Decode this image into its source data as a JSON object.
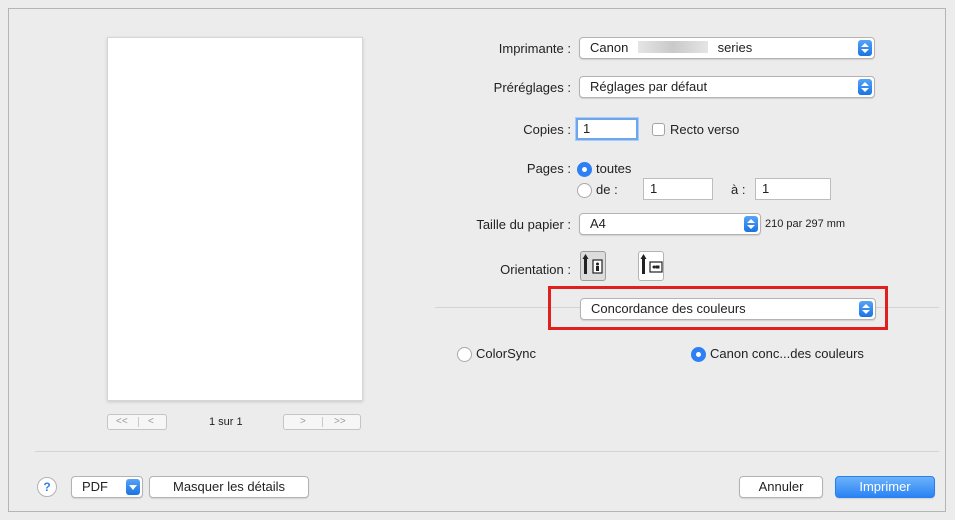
{
  "printer": {
    "label": "Imprimante :",
    "value": "Canon",
    "value_suffix": "series"
  },
  "presets": {
    "label": "Préréglages :",
    "value": "Réglages par défaut"
  },
  "copies": {
    "label": "Copies :",
    "value": "1",
    "duplex_label": "Recto verso"
  },
  "pages": {
    "label": "Pages :",
    "all_label": "toutes",
    "from_label": "de :",
    "from_value": "1",
    "to_label": "à :",
    "to_value": "1"
  },
  "paper": {
    "label": "Taille du papier :",
    "value": "A4",
    "dimensions": "210 par 297 mm"
  },
  "orientation": {
    "label": "Orientation :"
  },
  "section": {
    "value": "Concordance des couleurs",
    "highlight_color": "#e0201f"
  },
  "color_options": {
    "colorsync_label": "ColorSync",
    "canon_label": "Canon conc...des couleurs"
  },
  "preview_nav": {
    "first": "<<",
    "prev": "<",
    "next": ">",
    "last": ">>",
    "page_label": "1 sur 1"
  },
  "footer": {
    "help": "?",
    "pdf": "PDF",
    "details": "Masquer les détails",
    "cancel": "Annuler",
    "print": "Imprimer"
  },
  "colors": {
    "accent": "#2d7ff5"
  }
}
